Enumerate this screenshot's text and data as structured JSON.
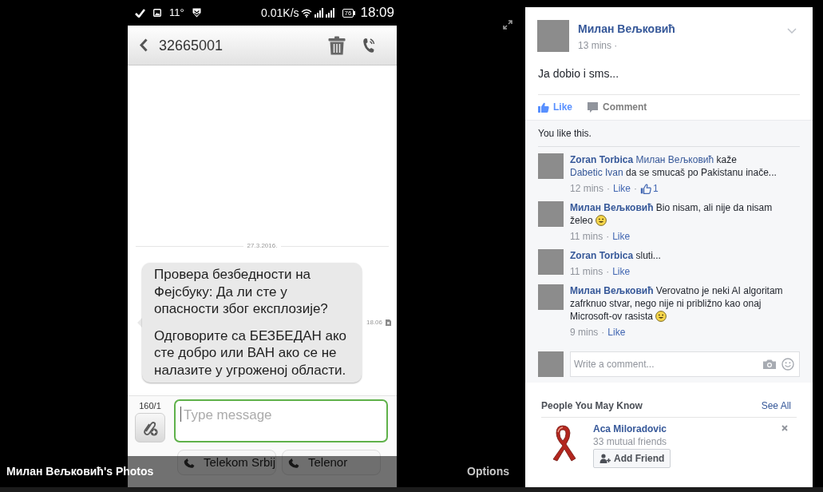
{
  "photo_viewer": {
    "phone": {
      "status_bar": {
        "temperature": "11°",
        "net_speed": "0.01K/s",
        "battery": "76",
        "time": "18:09"
      },
      "header": {
        "contact": "32665001"
      },
      "date_divider": "27.3.2016.",
      "message": {
        "paragraphs": [
          "Провера безбедности на Фејсбуку: Да ли сте у опасности због експлозије?",
          "Одговорите са БЕЗБЕДАН ако сте добро или ВАН ако се не налазите у угроженој области."
        ],
        "time": "18.06"
      },
      "compose": {
        "counter": "160/1",
        "placeholder": "Type message",
        "focused": true
      },
      "sim_buttons": [
        {
          "label": "Telekom Srbij"
        },
        {
          "label": "Telenor"
        }
      ]
    },
    "caption": "Милан Вељковић's Photos",
    "options": "Options"
  },
  "post": {
    "author": "Милан Вељковић",
    "time": "13 mins ·",
    "text": "Ja dobio i sms...",
    "liked": true,
    "like_label": "Like",
    "comment_label": "Comment",
    "likes_summary": "You like this.",
    "comments": [
      {
        "author": "Zoran Torbica",
        "body": [
          {
            "kind": "mention",
            "text": "Милан Вељковић"
          },
          {
            "kind": "text",
            "text": "kaže"
          },
          {
            "kind": "mention",
            "text": "Dabetic Ivan"
          },
          {
            "kind": "text",
            "text": "da se smucaš po Pakistanu inače..."
          }
        ],
        "smiley": false,
        "meta": [
          {
            "kind": "time",
            "text": "12 mins"
          },
          {
            "kind": "sep",
            "text": "·"
          },
          {
            "kind": "link",
            "text": "Like"
          },
          {
            "kind": "sep",
            "text": "·"
          },
          {
            "kind": "likes",
            "text": "1"
          }
        ]
      },
      {
        "author": "Милан Вељковић",
        "body": [
          {
            "kind": "text",
            "text": "Bio nisam, ali nije da nisam želeo"
          }
        ],
        "smiley": true,
        "meta": [
          {
            "kind": "time",
            "text": "11 mins"
          },
          {
            "kind": "sep",
            "text": "·"
          },
          {
            "kind": "link",
            "text": "Like"
          }
        ]
      },
      {
        "author": "Zoran Torbica",
        "body": [
          {
            "kind": "text",
            "text": "sluti..."
          }
        ],
        "smiley": false,
        "meta": [
          {
            "kind": "time",
            "text": "11 mins"
          },
          {
            "kind": "sep",
            "text": "·"
          },
          {
            "kind": "link",
            "text": "Like"
          }
        ]
      },
      {
        "author": "Милан Вељковић",
        "body": [
          {
            "kind": "text",
            "text": "Verovatno je neki AI algoritam zafrknuo stvar, nego nije ni približno kao onaj Microsoft-ov rasista"
          }
        ],
        "smiley": true,
        "meta": [
          {
            "kind": "time",
            "text": "9 mins"
          },
          {
            "kind": "sep",
            "text": "·"
          },
          {
            "kind": "link",
            "text": "Like"
          }
        ]
      }
    ],
    "comment_box": {
      "placeholder": "Write a comment..."
    }
  },
  "people_you_may_know": {
    "title": "People You May Know",
    "see_all": "See All",
    "people": [
      {
        "name": "Aca Miloradovic",
        "mutual": "33 mutual friends",
        "button": "Add Friend"
      }
    ]
  }
}
